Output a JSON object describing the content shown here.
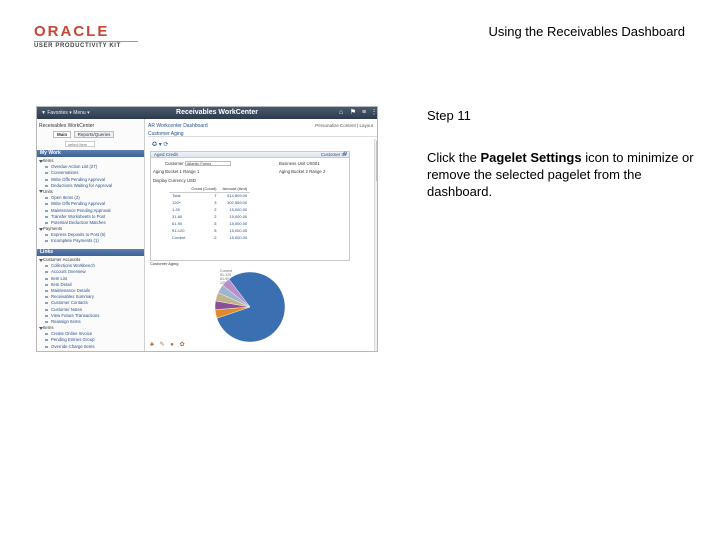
{
  "header": {
    "logo_brand": "ORACLE",
    "logo_sub": "USER PRODUCTIVITY KIT",
    "doc_title": "Using the Receivables Dashboard"
  },
  "step": {
    "title": "Step 11",
    "instruction_pre": "Click the ",
    "instruction_bold": "Pagelet Settings",
    "instruction_post": " icon to minimize or remove the selected pagelet from the dashboard."
  },
  "screenshot": {
    "topbar": {
      "favorites": "▼ Favorites ▾ Menu ▾",
      "app_title": "Receivables WorkCenter",
      "icons": [
        "home-icon",
        "flag-icon",
        "menu-icon",
        "more-icon"
      ]
    },
    "left_pane": {
      "header": "Receivables WorkCenter",
      "tabs": [
        "Main",
        "Reports/Queries"
      ],
      "search": "select item",
      "sections": [
        {
          "title": "My Work",
          "items": [
            {
              "label": "Items",
              "hdr": true
            },
            {
              "label": "Overdue Action List (27)",
              "hdr": false
            },
            {
              "label": "Conversations",
              "hdr": false
            },
            {
              "label": "Write Offs Pending Approval",
              "hdr": false
            },
            {
              "label": "Deductions Waiting for Approval",
              "hdr": false
            },
            {
              "label": "Units",
              "hdr": true
            },
            {
              "label": "Open Items (2)",
              "hdr": false
            },
            {
              "label": "Write Offs Pending Approval",
              "hdr": false
            },
            {
              "label": "Maintenance Pending Approval",
              "hdr": false
            },
            {
              "label": "Transfer Worksheets to Post",
              "hdr": false
            },
            {
              "label": "Potential Deduction Matches",
              "hdr": false
            },
            {
              "label": "Payments",
              "hdr": true
            },
            {
              "label": "Express Deposits to Post (6)",
              "hdr": false
            },
            {
              "label": "Incomplete Payments (1)",
              "hdr": false
            }
          ]
        },
        {
          "title": "Links",
          "items": [
            {
              "label": "Customer Accounts",
              "hdr": true
            },
            {
              "label": "Collections Workbench",
              "hdr": false
            },
            {
              "label": "Account Overview",
              "hdr": false
            },
            {
              "label": "Item List",
              "hdr": false
            },
            {
              "label": "Item Detail",
              "hdr": false
            },
            {
              "label": "Maintenance Details",
              "hdr": false
            },
            {
              "label": "Receivables Summary",
              "hdr": false
            },
            {
              "label": "Customer Contacts",
              "hdr": false
            },
            {
              "label": "Customer Notes",
              "hdr": false
            },
            {
              "label": "View Future Transactions",
              "hdr": false
            },
            {
              "label": "Reassign Items",
              "hdr": false
            },
            {
              "label": "Items",
              "hdr": true
            },
            {
              "label": "Create Online Invoice",
              "hdr": false
            },
            {
              "label": "Pending Entries Group",
              "hdr": false
            },
            {
              "label": "Override Charge Items",
              "hdr": false
            },
            {
              "label": "Inquiries/List",
              "hdr": false
            }
          ]
        }
      ]
    },
    "main": {
      "crumb": "AR Workcenter Dashboard",
      "right": "Personalize Content | Layout",
      "sub_title": "Customer Aging",
      "tools": "✪ ▾ ⟳",
      "pagelet": {
        "title": "Aged Credit",
        "header_right": "Customer ID",
        "customer_label": "Customer",
        "customer_value": "Atlantic Farms",
        "bu_label": "Business Unit",
        "bu_value": "US001",
        "aging_id_1_label": "Aging Bucket 1",
        "aging_id_1_value": "Range 1",
        "aging_id_2_label": "Aging Bucket 2",
        "aging_id_2_value": "Range 2",
        "display_label": "Display Currency",
        "display_value": "USD",
        "table_headers": [
          "",
          "Count (Count)",
          "Amount (Amt)"
        ],
        "rows": [
          {
            "range": "Total",
            "count": "7",
            "amount": "514,809.00"
          },
          {
            "range": "120+",
            "count": "3",
            "amount": "302,559.00"
          },
          {
            "range": "1-30",
            "count": "2",
            "amount": "15,000.00"
          },
          {
            "range": "31-60",
            "count": "2",
            "amount": "15,000.00"
          },
          {
            "range": "61-90",
            "count": "5",
            "amount": "15,000.00"
          },
          {
            "range": "91-120",
            "count": "5",
            "amount": "15,000.00"
          },
          {
            "range": "Current",
            "count": "2",
            "amount": "15,000.00"
          }
        ]
      },
      "pie": {
        "label": "Customer Aging",
        "notes": [
          "Current",
          "91-120",
          "61-90",
          "120+"
        ]
      },
      "bottom_icons": "♣ ✎ ● ✿"
    }
  },
  "chart_data": {
    "type": "pie",
    "categories": [
      "120+",
      "1-30",
      "31-60",
      "61-90",
      "91-120",
      "Current"
    ],
    "values": [
      302559,
      15000,
      15000,
      15000,
      15000,
      15000
    ],
    "colors": [
      "#3a6fb2",
      "#e08a2c",
      "#8a4f98",
      "#c0b48a",
      "#9fb4cf",
      "#b98fc9"
    ]
  }
}
